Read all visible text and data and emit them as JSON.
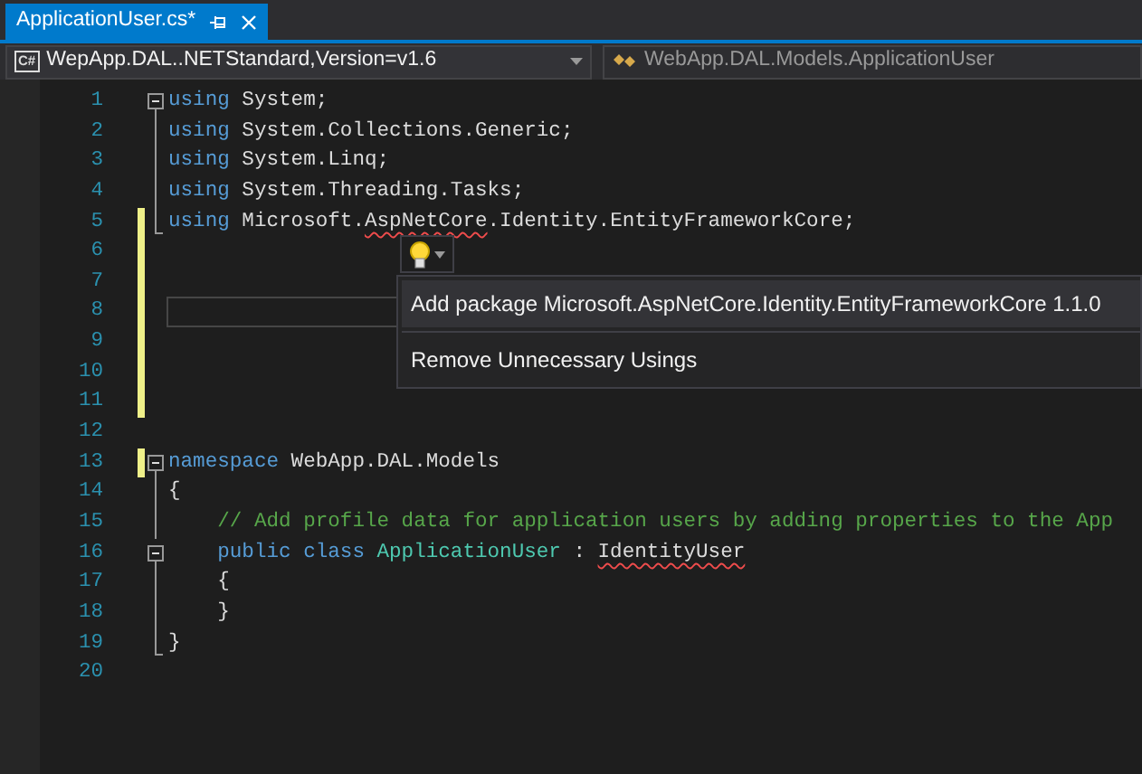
{
  "tabs": [
    {
      "label": "ApplicationUser.cs*",
      "selected": true
    }
  ],
  "nav_bar": {
    "project_icon": "C#",
    "project": "WepApp.DAL..NETStandard,Version=v1.6",
    "type": "WebApp.DAL.Models.ApplicationUser"
  },
  "lines": [
    {
      "number": "1",
      "kind": "fold-start",
      "changed": false,
      "current": false,
      "tokens": [
        {
          "kind": "keyword",
          "text": "using"
        },
        {
          "kind": "plain",
          "text": " System;"
        }
      ]
    },
    {
      "number": "2",
      "kind": "fold-body",
      "changed": false,
      "current": false,
      "tokens": [
        {
          "kind": "keyword",
          "text": "using"
        },
        {
          "kind": "plain",
          "text": " System.Collections.Generic;"
        }
      ]
    },
    {
      "number": "3",
      "kind": "fold-body",
      "changed": false,
      "current": false,
      "tokens": [
        {
          "kind": "keyword",
          "text": "using"
        },
        {
          "kind": "plain",
          "text": " System.Linq;"
        }
      ]
    },
    {
      "number": "4",
      "kind": "fold-body",
      "changed": false,
      "current": false,
      "tokens": [
        {
          "kind": "keyword",
          "text": "using"
        },
        {
          "kind": "plain",
          "text": " System.Threading.Tasks;"
        }
      ]
    },
    {
      "number": "5",
      "kind": "fold-end",
      "changed": true,
      "current": false,
      "tokens": [
        {
          "kind": "keyword",
          "text": "using"
        },
        {
          "kind": "plain",
          "text": " Microsoft."
        },
        {
          "kind": "plain",
          "text": "AspNetCore",
          "error": true
        },
        {
          "kind": "plain",
          "text": ".Identity.EntityFrameworkCore;"
        }
      ]
    },
    {
      "number": "6",
      "kind": "plain",
      "changed": true,
      "current": false
    },
    {
      "number": "7",
      "kind": "plain",
      "changed": true,
      "current": false
    },
    {
      "number": "8",
      "kind": "plain",
      "changed": true,
      "current": true
    },
    {
      "number": "9",
      "kind": "plain",
      "changed": true,
      "current": false
    },
    {
      "number": "10",
      "kind": "plain",
      "changed": true,
      "current": false
    },
    {
      "number": "11",
      "kind": "plain",
      "changed": true,
      "current": false
    },
    {
      "number": "12",
      "kind": "plain",
      "changed": false,
      "current": false
    },
    {
      "number": "13",
      "kind": "fold-start",
      "changed": true,
      "current": false,
      "tokens": [
        {
          "kind": "keyword",
          "text": "namespace"
        },
        {
          "kind": "plain",
          "text": " WebApp.DAL.Models"
        }
      ]
    },
    {
      "number": "14",
      "kind": "fold-body",
      "changed": false,
      "current": false,
      "tokens": [
        {
          "kind": "plain",
          "text": "{"
        }
      ]
    },
    {
      "number": "15",
      "kind": "fold-body",
      "changed": false,
      "current": false,
      "tokens": [
        {
          "kind": "comment",
          "text": "    // Add profile data for application users by adding properties to the App"
        }
      ]
    },
    {
      "number": "16",
      "kind": "fold-start",
      "changed": false,
      "current": false,
      "tokens": [
        {
          "kind": "keyword",
          "text": "    public class"
        },
        {
          "kind": "type",
          "text": " ApplicationUser"
        },
        {
          "kind": "plain",
          "text": " : "
        },
        {
          "kind": "plain",
          "text": "IdentityUser",
          "error": true
        }
      ]
    },
    {
      "number": "17",
      "kind": "fold-body",
      "changed": false,
      "current": false,
      "tokens": [
        {
          "kind": "plain",
          "text": "    {"
        }
      ]
    },
    {
      "number": "18",
      "kind": "fold-body",
      "changed": false,
      "current": false,
      "tokens": [
        {
          "kind": "plain",
          "text": "    }"
        }
      ]
    },
    {
      "number": "19",
      "kind": "fold-end",
      "changed": false,
      "current": false,
      "tokens": [
        {
          "kind": "plain",
          "text": "}"
        }
      ]
    },
    {
      "number": "20",
      "kind": "plain",
      "changed": false,
      "current": false
    }
  ],
  "quick_actions": {
    "items": [
      {
        "label": "Add package Microsoft.AspNetCore.Identity.EntityFrameworkCore 1.1.0",
        "selected": true
      },
      {
        "label": "Remove Unnecessary Usings",
        "selected": false
      }
    ]
  }
}
